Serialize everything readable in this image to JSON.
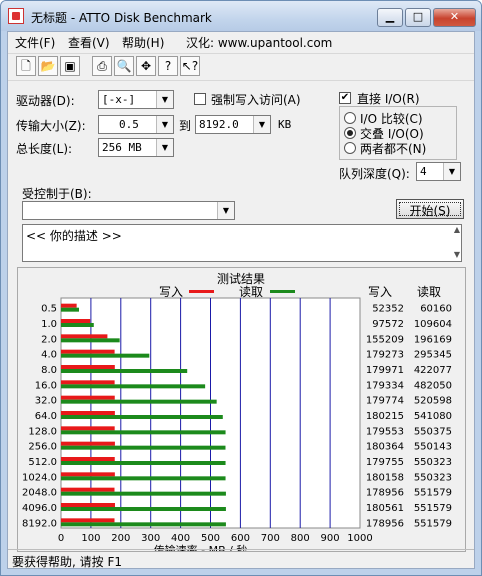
{
  "window": {
    "title": "无标题 - ATTO Disk Benchmark"
  },
  "menu": [
    "文件(F)",
    "查看(V)",
    "帮助(H)",
    "汉化: www.upantool.com"
  ],
  "toolbar_icons": [
    "new-icon",
    "open-icon",
    "save-icon",
    "print-icon",
    "print-preview-icon",
    "move-icon",
    "help-icon",
    "context-help-icon"
  ],
  "controls": {
    "drive_label": "驱动器(D):",
    "drive_value": "[-x-]",
    "force_write_label": "强制写入访问(A)",
    "transfer_label": "传输大小(Z):",
    "transfer_from": "0.5",
    "to_label": "到",
    "transfer_to": "8192.0",
    "kb_label": "KB",
    "total_label": "总长度(L):",
    "total_value": "256 MB",
    "direct_io_label": "直接 I/O(R)",
    "direct_io_checked": true,
    "io_compare_label": "I/O 比较(C)",
    "overlap_io_label": "交叠 I/O(O)",
    "neither_label": "两者都不(N)",
    "queue_label": "队列深度(Q):",
    "queue_value": "4",
    "controlled_label": "受控制于(B):",
    "controlled_value": "",
    "start_label": "开始(S)",
    "description": "<<  你的描述  >>"
  },
  "results": {
    "title": "测试结果",
    "write_legend": "写入",
    "read_legend": "读取",
    "col_write": "写入",
    "col_read": "读取"
  },
  "chart_data": {
    "type": "bar",
    "orientation": "horizontal",
    "categories": [
      "0.5",
      "1.0",
      "2.0",
      "4.0",
      "8.0",
      "16.0",
      "32.0",
      "64.0",
      "128.0",
      "256.0",
      "512.0",
      "1024.0",
      "2048.0",
      "4096.0",
      "8192.0"
    ],
    "series": [
      {
        "name": "写入",
        "color": "#e8191a",
        "values": [
          52352,
          97572,
          155209,
          179273,
          179971,
          179334,
          179774,
          180215,
          179553,
          180364,
          179755,
          180158,
          178956,
          180561,
          178956
        ]
      },
      {
        "name": "读取",
        "color": "#1c8a1c",
        "values": [
          60160,
          109604,
          196169,
          295345,
          422077,
          482050,
          520598,
          541080,
          550375,
          550143,
          550323,
          550323,
          551579,
          551579,
          551579
        ]
      }
    ],
    "xlabel": "传输速率 - MB / 秒",
    "xticks": [
      "0",
      "100",
      "200",
      "300",
      "400",
      "500",
      "600",
      "700",
      "800",
      "900",
      "1000"
    ],
    "xlim": [
      0,
      1000
    ],
    "grid": true
  },
  "status": {
    "text": "要获得帮助, 请按 F1"
  }
}
